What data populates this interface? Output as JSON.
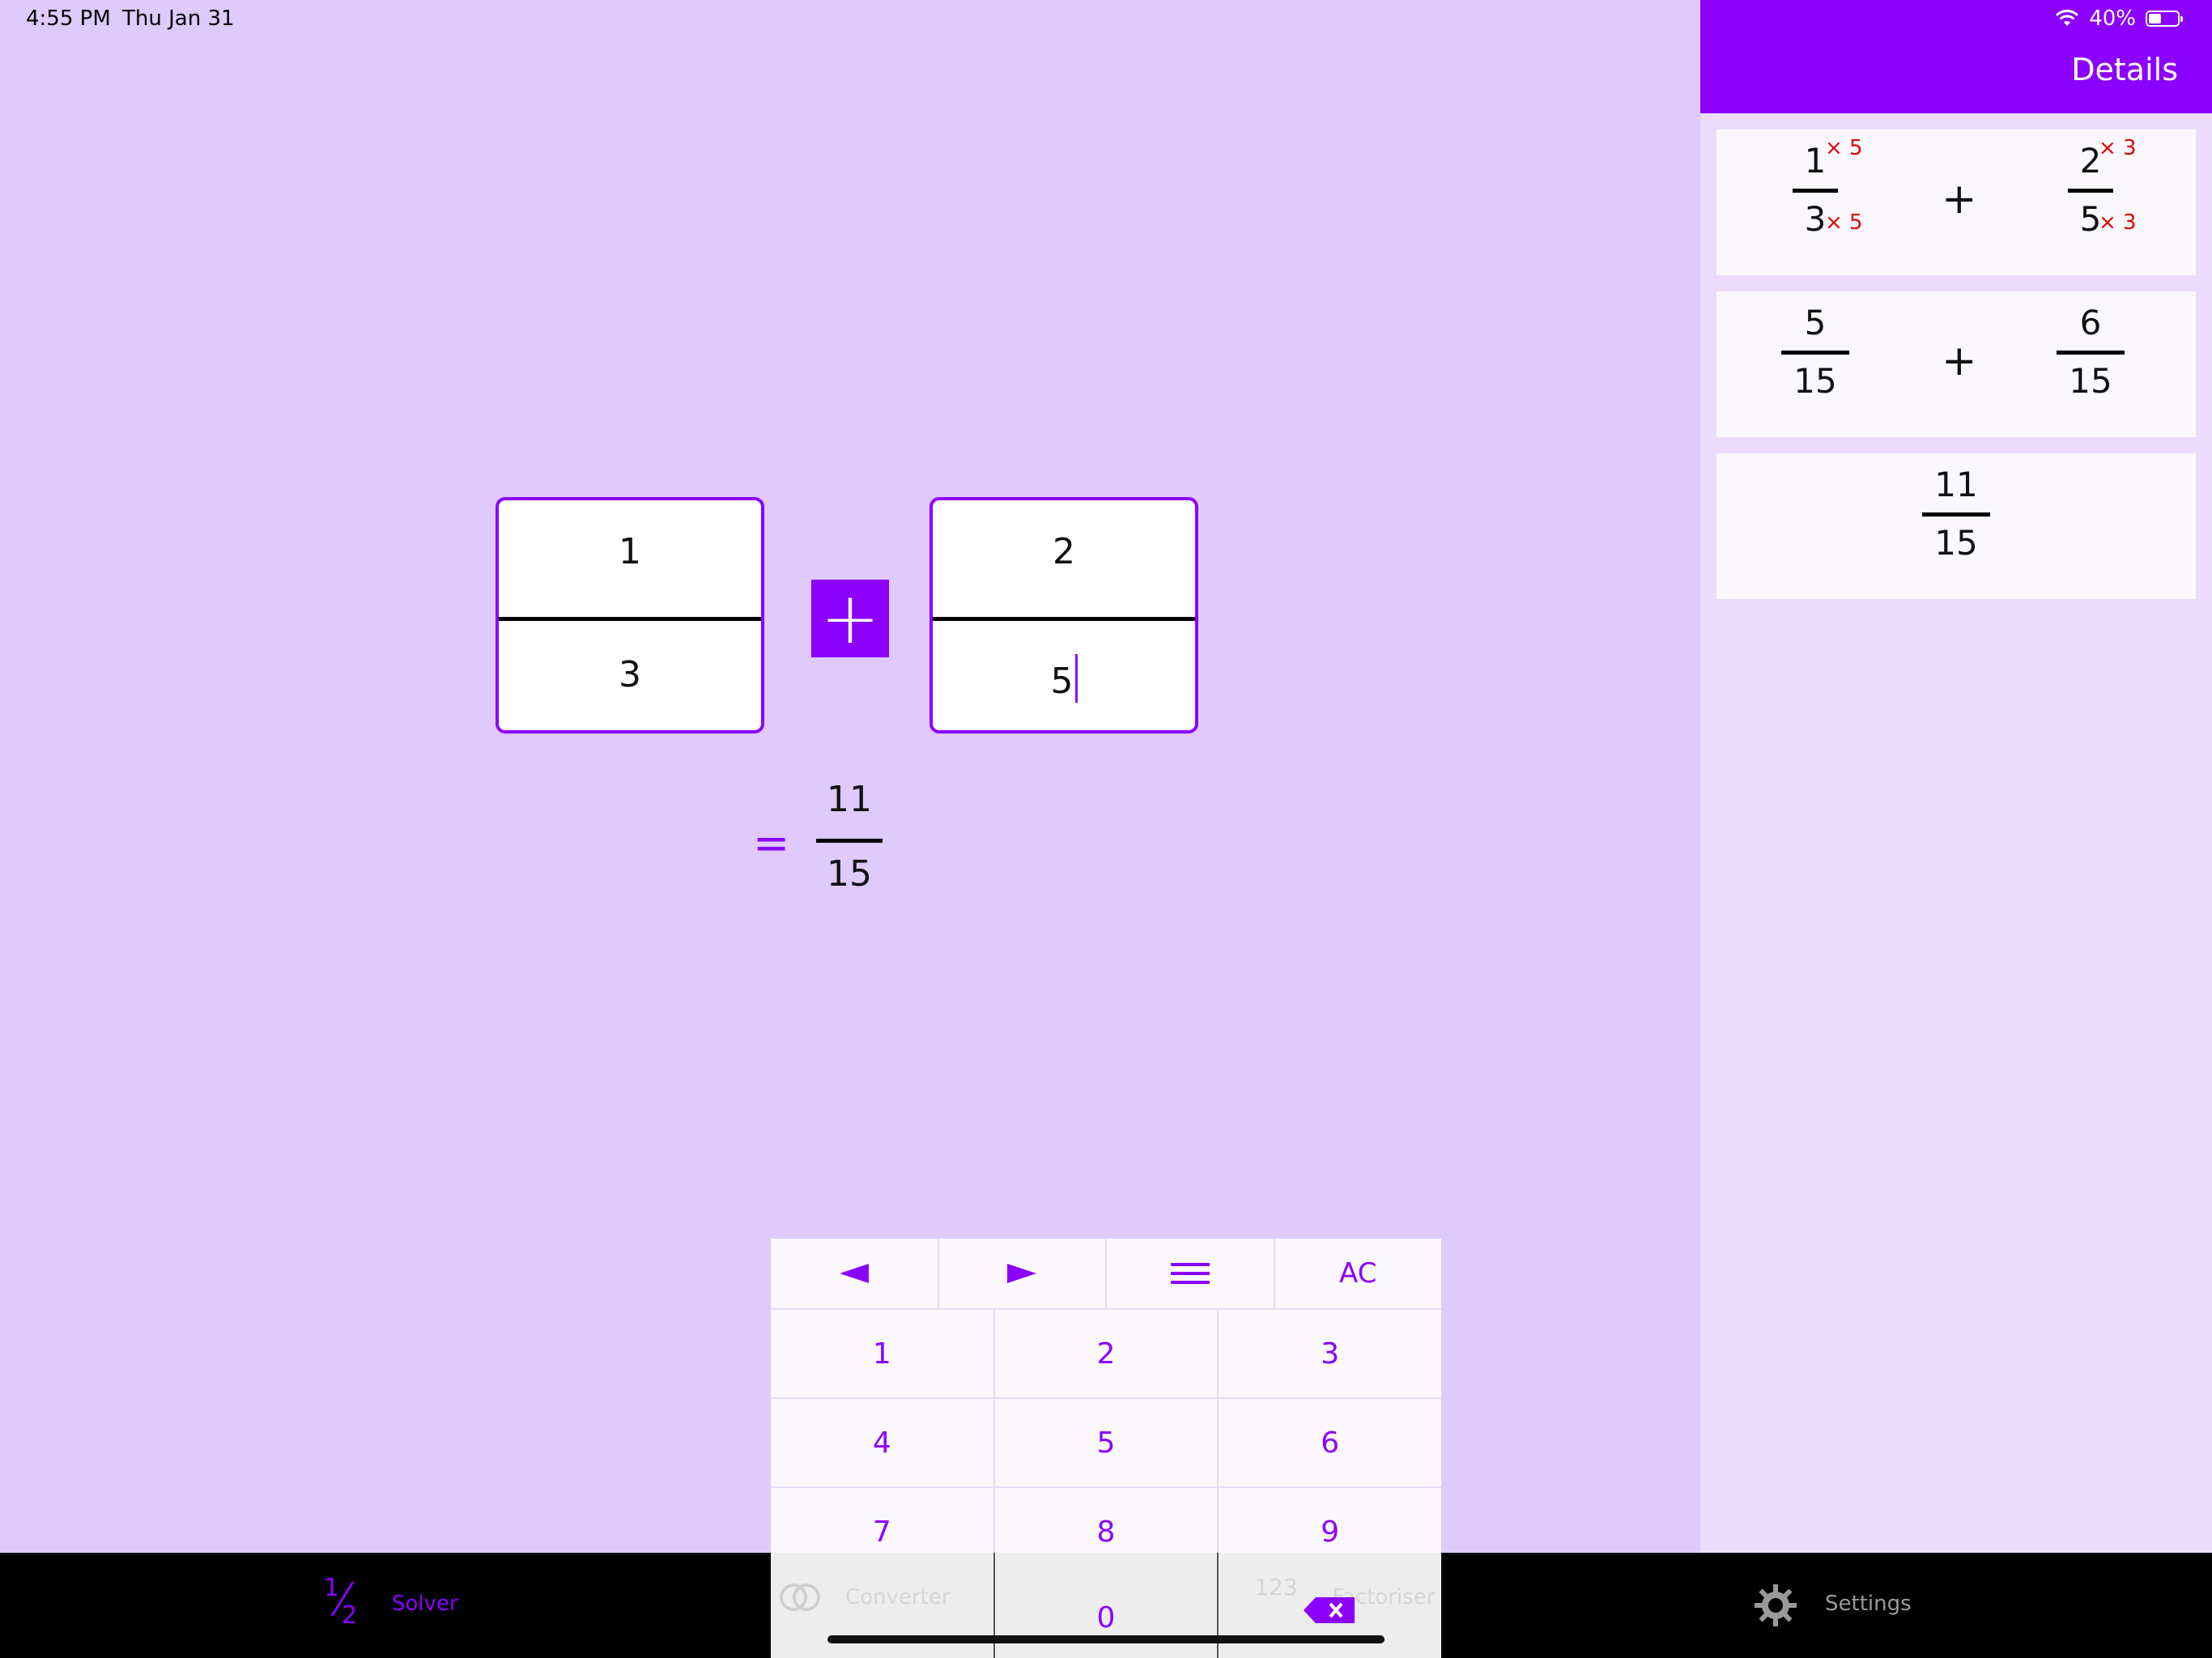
{
  "status_bar": {
    "time": "4:55 PM",
    "date": "Thu Jan 31",
    "battery": "40%"
  },
  "solver": {
    "fraction_left": {
      "numerator": "1",
      "denominator": "3"
    },
    "operator": "+",
    "fraction_right": {
      "numerator": "2",
      "denominator": "5"
    },
    "equals": "=",
    "result": {
      "numerator": "11",
      "denominator": "15"
    }
  },
  "details": {
    "title": "Details",
    "step1": {
      "left": {
        "numerator": "1",
        "denominator": "3",
        "num_multiplier": "× 5",
        "den_multiplier": "× 5"
      },
      "operator": "+",
      "right": {
        "numerator": "2",
        "denominator": "5",
        "num_multiplier": "× 3",
        "den_multiplier": "× 3"
      }
    },
    "step2": {
      "left": {
        "numerator": "5",
        "denominator": "15"
      },
      "operator": "+",
      "right": {
        "numerator": "6",
        "denominator": "15"
      }
    },
    "step3": {
      "numerator": "11",
      "denominator": "15"
    }
  },
  "keyboard": {
    "top_row": {
      "left_icon": "arrow-left-icon",
      "right_icon": "arrow-right-icon",
      "menu_icon": "menu-icon",
      "clear": "AC"
    },
    "keys": [
      [
        "1",
        "2",
        "3"
      ],
      [
        "4",
        "5",
        "6"
      ],
      [
        "7",
        "8",
        "9"
      ]
    ],
    "zero": "0",
    "delete_icon": "backspace-icon"
  },
  "tab_bar": {
    "tabs": [
      {
        "label": "Solver",
        "icon": "half-fraction-icon",
        "selected": true
      },
      {
        "label": "Converter",
        "icon": "converter-icon",
        "selected": false
      },
      {
        "label": "Factoriser",
        "icon": "factoriser-icon",
        "selected": false
      },
      {
        "label": "Settings",
        "icon": "gear-icon",
        "selected": false
      }
    ],
    "solver_icon_text": {
      "num": "1",
      "den": "2"
    },
    "factoriser_icon_text": "123"
  },
  "colors": {
    "accent": "#8b00ff",
    "background": "#dfc9fd",
    "panel": "#ebdcfd",
    "multiplier": "#e00000"
  }
}
